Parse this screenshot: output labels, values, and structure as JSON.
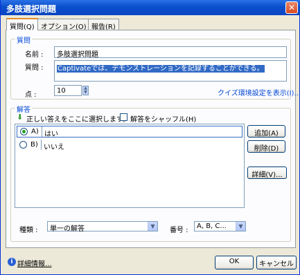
{
  "window": {
    "title": "多肢選択問題"
  },
  "tabs": [
    {
      "label": "質問(Q)"
    },
    {
      "label": "オプション(O)"
    },
    {
      "label": "報告(R)"
    }
  ],
  "question": {
    "group_title": "質問",
    "name_label": "名前 :",
    "name_value": "多肢選択問題",
    "question_label": "質問 :",
    "question_value": "Captivateでは、デモンストレーションを記録することができる。",
    "points_label": "点 :",
    "points_value": "10",
    "quiz_settings_link": "クイズ環境設定を表示(I)..."
  },
  "answers": {
    "group_title": "解答",
    "instruction": "正しい答えをここに選択します。",
    "shuffle_label": "解答をシャッフル(H)",
    "shuffle_checked": false,
    "items": [
      {
        "letter": "A)",
        "text": "はい",
        "selected": true
      },
      {
        "letter": "B)",
        "text": "いいえ",
        "selected": false
      }
    ],
    "add_button": "追加(A)",
    "delete_button": "削除(D)",
    "detail_button": "詳細(V)...",
    "type_label": "種類 :",
    "type_value": "単一の解答",
    "numbering_label": "番号 :",
    "numbering_value": "A, B, C..."
  },
  "footer": {
    "more_info_link": "詳細情報...",
    "ok_button": "OK",
    "cancel_button": "キャンセル"
  }
}
